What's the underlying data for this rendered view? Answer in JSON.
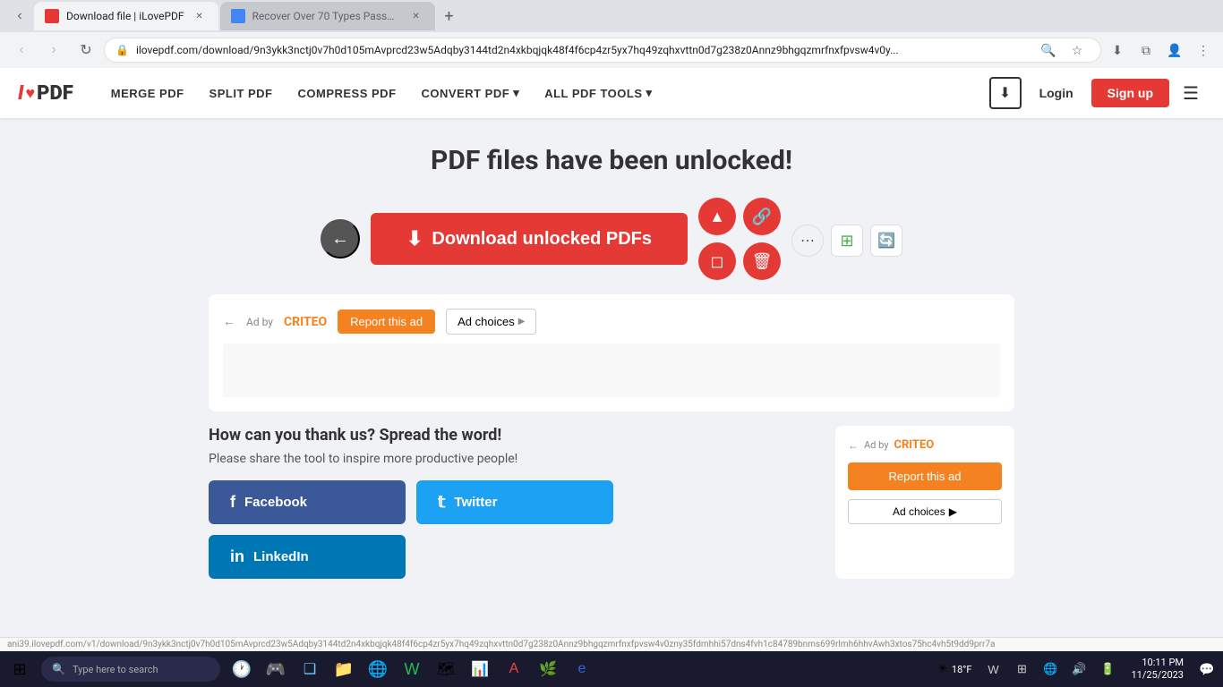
{
  "browser": {
    "tabs": [
      {
        "id": "tab1",
        "label": "Download file | iLovePDF",
        "favicon_color": "red",
        "active": true
      },
      {
        "id": "tab2",
        "label": "Recover Over 70 Types Passwo...",
        "favicon_color": "blue",
        "active": false
      }
    ],
    "address_bar": {
      "url": "ilovepdf.com/download/9n3ykk3nctj0v7h0d105mAvprcd23w5Adqby3144td2n4xkbqjqk48f4f6cp4zr5yx7hq49zqhxvttn0d7g238z0Annz9bhgqzmrfnxfpvsw4v0y..."
    }
  },
  "header": {
    "logo": {
      "i": "I",
      "heart": "♥",
      "pdf": "PDF"
    },
    "nav": [
      {
        "label": "MERGE PDF",
        "key": "merge-pdf"
      },
      {
        "label": "SPLIT PDF",
        "key": "split-pdf"
      },
      {
        "label": "COMPRESS PDF",
        "key": "compress-pdf"
      },
      {
        "label": "CONVERT PDF",
        "key": "convert-pdf",
        "has_dropdown": true
      },
      {
        "label": "ALL PDF TOOLS",
        "key": "all-tools",
        "has_dropdown": true
      }
    ],
    "login_label": "Login",
    "signup_label": "Sign up",
    "menu_icon": "☰"
  },
  "main": {
    "success_title": "PDF files have been unlocked!",
    "download_btn_label": "Download unlocked PDFs",
    "back_aria": "back"
  },
  "ad_section": {
    "ad_by_label": "Ad by",
    "criteo_label": "CRITEO",
    "report_ad_label": "Report this ad",
    "ad_choices_label": "Ad choices",
    "back_arrow": "←"
  },
  "share_section": {
    "title": "How can you thank us? Spread the word!",
    "subtitle": "Please share the tool to inspire more productive people!",
    "facebook_label": "Facebook",
    "twitter_label": "Twitter",
    "linkedin_label": "LinkedIn"
  },
  "right_ad": {
    "back_arrow": "←",
    "ad_by_label": "Ad by",
    "criteo_label": "CRITEO",
    "report_ad_label": "Report this ad",
    "ad_choices_label": "Ad choices"
  },
  "taskbar": {
    "search_placeholder": "Type here to search",
    "time": "10:11 PM",
    "date": "11/25/2023",
    "weather_temp": "18°F",
    "apps": [
      {
        "icon": "⊞",
        "name": "start"
      },
      {
        "icon": "🕐",
        "name": "clock-app"
      },
      {
        "icon": "🎮",
        "name": "game-app"
      },
      {
        "icon": "📋",
        "name": "taskview"
      },
      {
        "icon": "📁",
        "name": "file-explorer"
      },
      {
        "icon": "🌐",
        "name": "chrome-browser"
      },
      {
        "icon": "📝",
        "name": "word-app"
      },
      {
        "icon": "🗺",
        "name": "maps-app"
      },
      {
        "icon": "📊",
        "name": "charts-app"
      },
      {
        "icon": "📄",
        "name": "acrobat-app"
      },
      {
        "icon": "🌿",
        "name": "green-app"
      },
      {
        "icon": "🌐",
        "name": "edge-browser"
      }
    ]
  },
  "status_bar": {
    "url": "ani39.ilovepdf.com/v1/download/9n3ykk3nctj0v7h0d105mAvprcd23w5Adqby3144td2n4xkbqjqk48f4f6cp4zr5yx7hq49zqhxvttn0d7g238z0Annz9bhgqzmrfnxfpvsw4v0zny35fdmhhi57dns4fvh1c84789bnms699rlmh6hhvAwh3xtos75hc4vh5t9dd9prr7a"
  }
}
